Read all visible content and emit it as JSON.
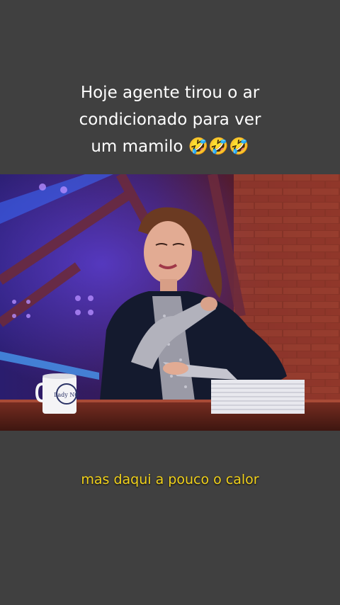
{
  "caption": {
    "line1": "Hoje agente tirou o ar",
    "line2": "condicionado para ver",
    "line3": "um mamilo 🤣🤣🤣"
  },
  "video": {
    "mug_text": "Lady NO"
  },
  "subtitle": {
    "text": "mas daqui a pouco o calor"
  },
  "colors": {
    "background": "#404040",
    "subtitle": "#f2d21b",
    "caption": "#ffffff"
  }
}
